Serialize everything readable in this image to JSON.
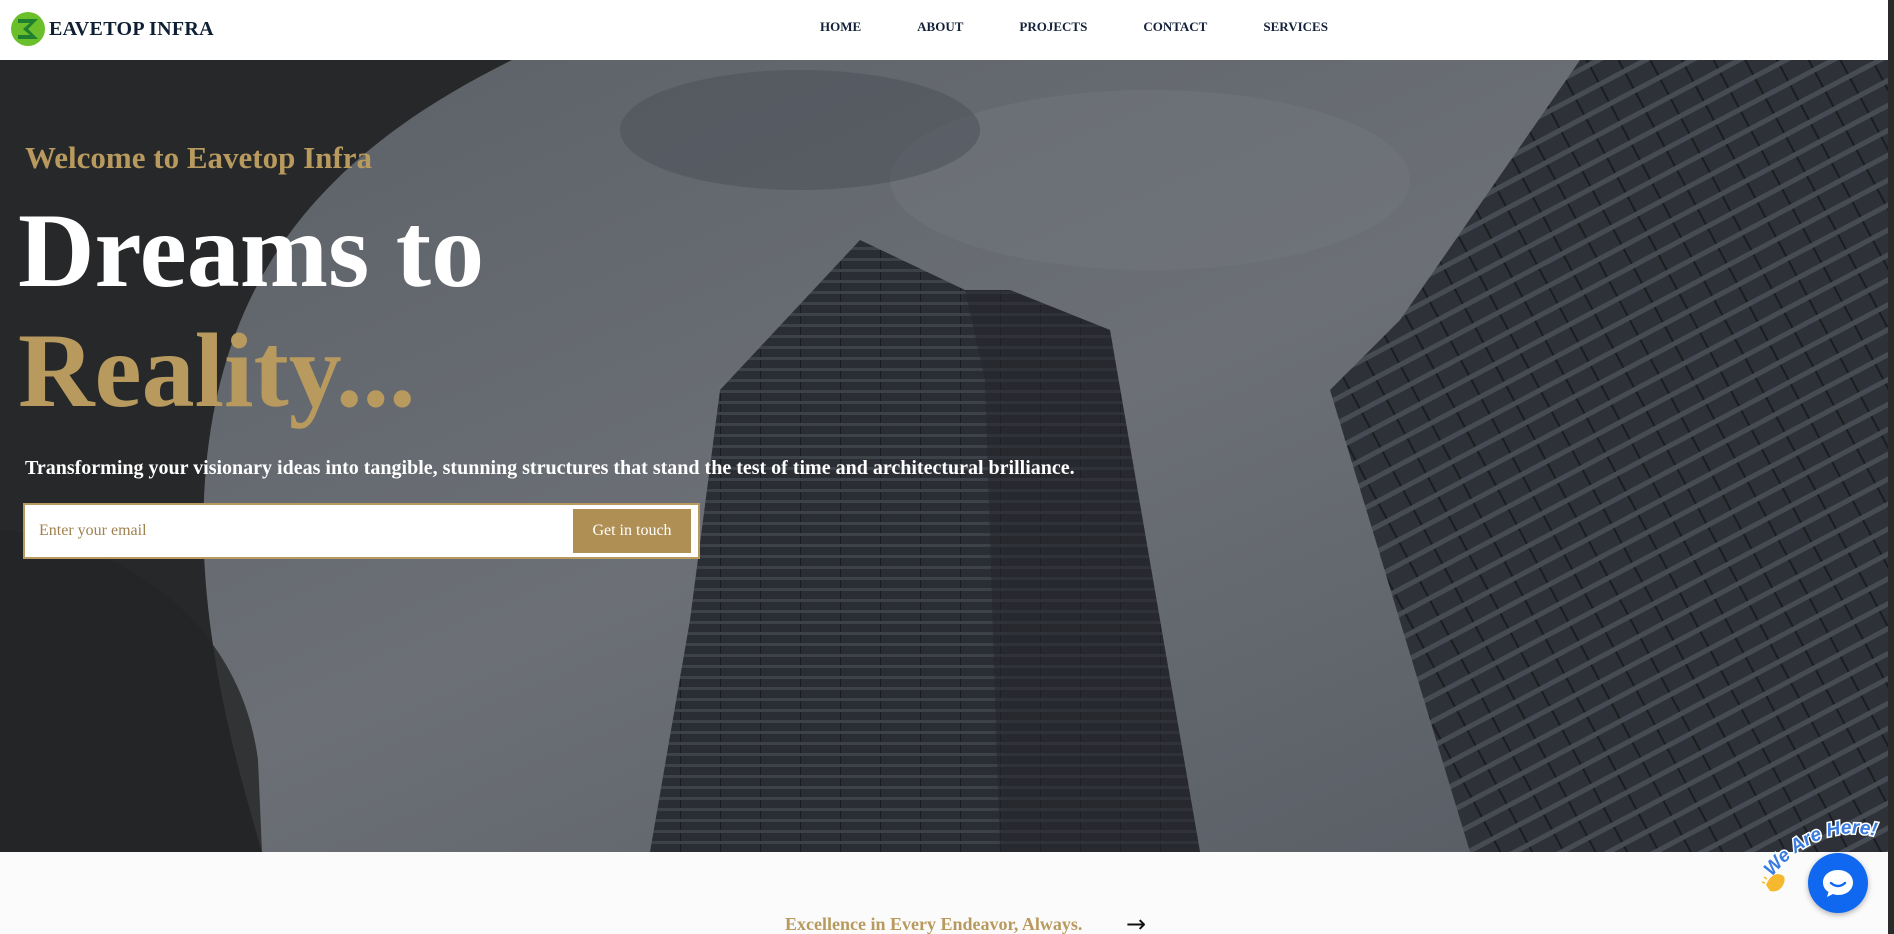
{
  "brand": {
    "name": "EAVETOP INFRA",
    "logo_icon": "eavetop-logo-icon",
    "logo_colors": [
      "#6abf2a",
      "#1e7f2e"
    ]
  },
  "nav": {
    "items": [
      {
        "label": "HOME"
      },
      {
        "label": "ABOUT"
      },
      {
        "label": "PROJECTS"
      },
      {
        "label": "CONTACT"
      },
      {
        "label": "SERVICES"
      }
    ]
  },
  "hero": {
    "welcome": "Welcome to Eavetop Infra",
    "headline_line1": "Dreams to",
    "headline_line2": "Reality...",
    "tagline": "Transforming your visionary ideas into tangible, stunning structures that stand the test of time and architectural brilliance.",
    "email_placeholder": "Enter your email",
    "cta_label": "Get in touch",
    "accent_color": "#b89a5e"
  },
  "section_teaser": {
    "text": "Excellence in Every Endeavor, Always.",
    "arrow": "→"
  },
  "chat": {
    "sticker_text": "We Are Here!",
    "sticker_icon": "waving-hand-icon",
    "button_icon": "chat-bubble-icon",
    "button_color": "#1068f0"
  }
}
